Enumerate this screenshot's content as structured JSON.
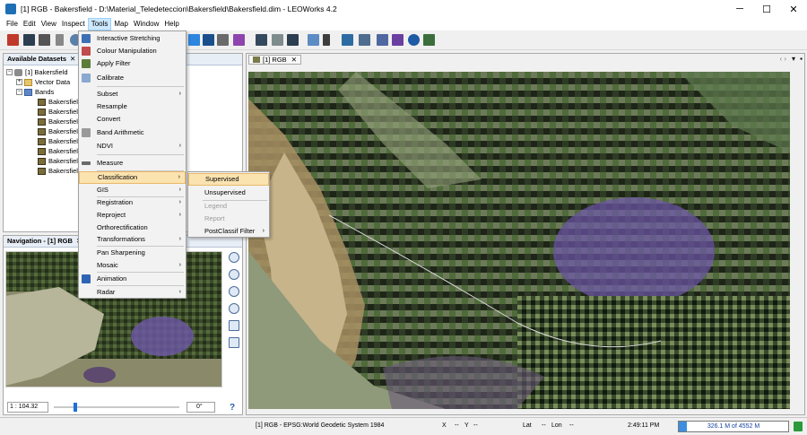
{
  "titlebar": {
    "title": "[1] RGB - Bakersfield - D:\\Material_Teledeteccion\\Bakersfield\\Bakersfield.dim - LEOWorks 4.2",
    "minimize": "─",
    "maximize": "☐",
    "close": "✕"
  },
  "menubar": {
    "items": [
      "File",
      "Edit",
      "View",
      "Inspect",
      "Tools",
      "Map",
      "Window",
      "Help"
    ]
  },
  "datasets_panel": {
    "title": "Available Datasets",
    "close": "✕",
    "tree": {
      "product": "[1] Bakersfield",
      "vector": "Vector Data",
      "bands_label": "Bands",
      "bands": [
        "Bakersfield",
        "Bakersfield",
        "Bakersfield",
        "Bakersfield",
        "Bakersfield",
        "Bakersfield",
        "Bakersfield",
        "Bakersfield"
      ]
    }
  },
  "navigation_panel": {
    "title": "Navigation - [1] RGB",
    "close": "✕",
    "scale": "1 : 104.32",
    "rotation": "0°",
    "help": "?"
  },
  "image_view": {
    "tab": "[1] RGB",
    "close": "✕"
  },
  "tools_menu": {
    "items": [
      {
        "label": "Interactive Stretching",
        "icon": "stretch-icon",
        "arrow": ""
      },
      {
        "label": "Colour Manipulation",
        "icon": "palette-icon",
        "arrow": ""
      },
      {
        "label": "Apply Filter",
        "icon": "filter-icon",
        "arrow": ""
      },
      {
        "label": "Calibrate",
        "icon": "calibrate-icon",
        "arrow": ""
      },
      {
        "label": "Subset",
        "icon": "",
        "arrow": "›"
      },
      {
        "label": "Resample",
        "icon": "",
        "arrow": ""
      },
      {
        "label": "Convert",
        "icon": "",
        "arrow": ""
      },
      {
        "label": "Band Arithmetic",
        "icon": "band-arithmetic-icon",
        "arrow": ""
      },
      {
        "label": "NDVI",
        "icon": "",
        "arrow": "›"
      },
      {
        "label": "Measure",
        "icon": "measure-icon",
        "arrow": ""
      },
      {
        "label": "Classification",
        "icon": "",
        "arrow": "›"
      },
      {
        "label": "GIS",
        "icon": "",
        "arrow": "›"
      },
      {
        "label": "Registration",
        "icon": "",
        "arrow": "›"
      },
      {
        "label": "Reproject",
        "icon": "",
        "arrow": "›"
      },
      {
        "label": "Orthorectification",
        "icon": "",
        "arrow": ""
      },
      {
        "label": "Transformations",
        "icon": "",
        "arrow": "›"
      },
      {
        "label": "Pan Sharpening",
        "icon": "",
        "arrow": ""
      },
      {
        "label": "Mosaic",
        "icon": "",
        "arrow": "›"
      },
      {
        "label": "Animation",
        "icon": "animation-icon",
        "arrow": ""
      },
      {
        "label": "Radar",
        "icon": "",
        "arrow": "›"
      }
    ]
  },
  "classification_submenu": {
    "items": [
      {
        "label": "Supervised",
        "arrow": ""
      },
      {
        "label": "Unsupervised",
        "arrow": ""
      },
      {
        "label": "Legend",
        "arrow": ""
      },
      {
        "label": "Report",
        "arrow": ""
      },
      {
        "label": "PostClassif Filter",
        "arrow": "›"
      }
    ]
  },
  "statusbar": {
    "crs": "[1] RGB - EPSG:World Geodetic System 1984",
    "x_label": "X",
    "x_value": "--",
    "y_label": "Y",
    "y_value": "--",
    "lat_label": "Lat",
    "lat_value": "--",
    "lon_label": "Lon",
    "lon_value": "--",
    "time": "2:49:11 PM",
    "memory": "326.1 M of 4552 M",
    "memory_fraction": 0.072
  },
  "colors": {
    "menu_highlight": "#fbe3b0",
    "panel_header": "#e8eef6",
    "memory_bar": "#3d8ede"
  }
}
